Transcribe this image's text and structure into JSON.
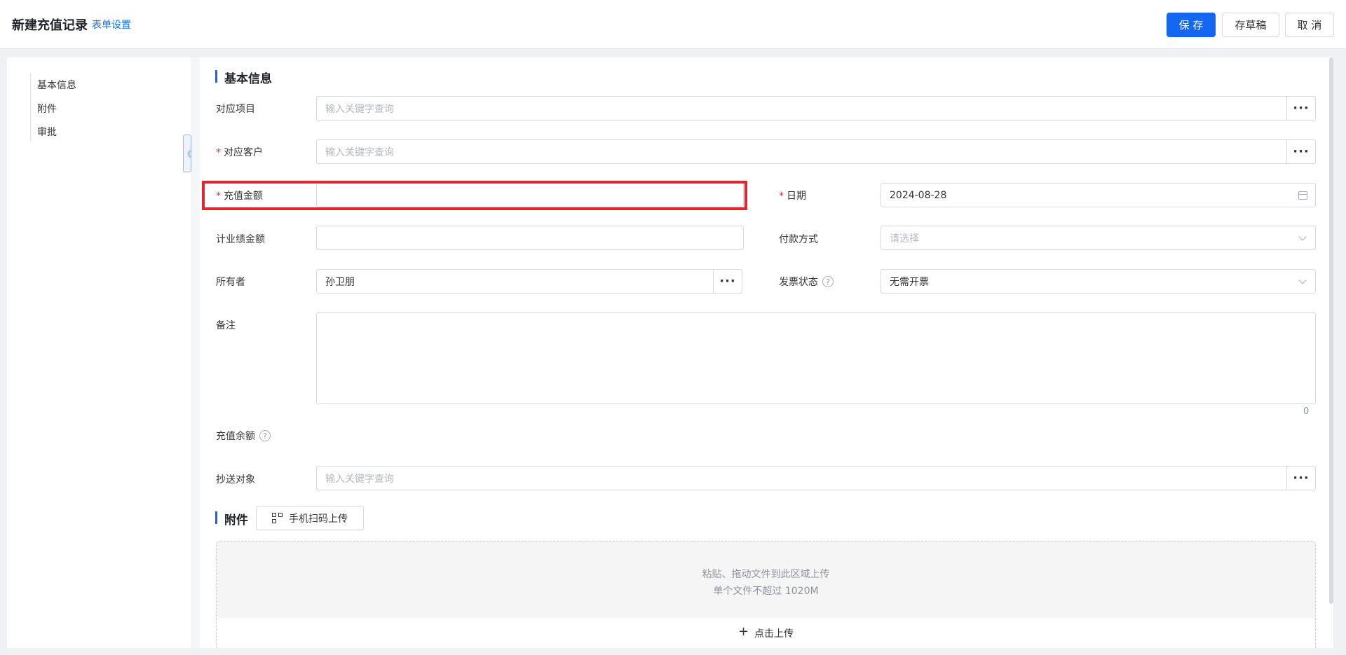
{
  "header": {
    "title": "新建充值记录",
    "form_settings": "表单设置",
    "save": "保 存",
    "draft": "存草稿",
    "cancel": "取 消"
  },
  "nav": {
    "items": [
      {
        "label": "基本信息"
      },
      {
        "label": "附件"
      },
      {
        "label": "审批"
      }
    ]
  },
  "collapse_glyph": "《",
  "sections": {
    "basic": "基本信息",
    "attachments": "附件"
  },
  "form": {
    "project": {
      "label": "对应项目",
      "placeholder": "输入关键字查询"
    },
    "customer": {
      "label": "对应客户",
      "placeholder": "输入关键字查询",
      "required": "*"
    },
    "amount": {
      "label": "充值金额",
      "value": "",
      "required": "*"
    },
    "date": {
      "label": "日期",
      "value": "2024-08-28",
      "required": "*"
    },
    "performance": {
      "label": "计业绩金额",
      "value": ""
    },
    "payment": {
      "label": "付款方式",
      "placeholder": "请选择"
    },
    "owner": {
      "label": "所有者",
      "value": "孙卫朋"
    },
    "invoice": {
      "label": "发票状态",
      "value": "无需开票"
    },
    "remark": {
      "label": "备注",
      "value": "",
      "counter": "0"
    },
    "balance": {
      "label": "充值余额"
    },
    "cc": {
      "label": "抄送对象",
      "placeholder": "输入关键字查询"
    }
  },
  "help_glyph": "?",
  "more_glyph": "···",
  "attachments": {
    "qr_upload": "手机扫码上传",
    "drop_line1": "粘贴、拖动文件到此区域上传",
    "drop_line2": "单个文件不超过 1020M",
    "click_upload": "点击上传",
    "plus_glyph": "+"
  }
}
